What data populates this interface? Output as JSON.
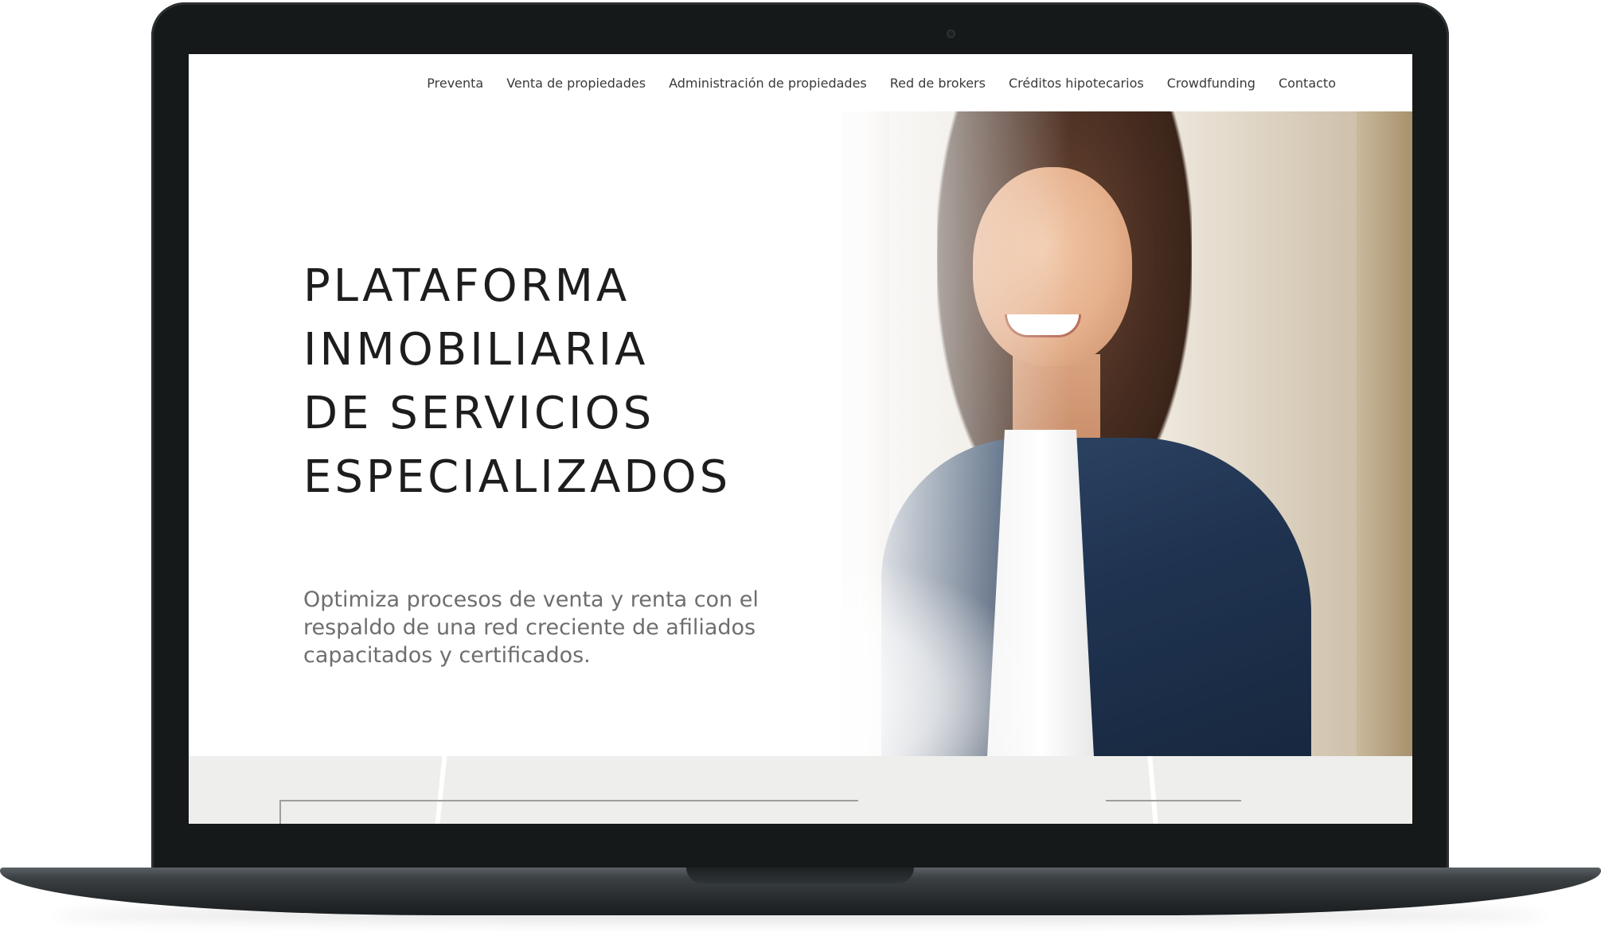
{
  "nav": {
    "items": [
      "Preventa",
      "Venta de propiedades",
      "Administración de propiedades",
      "Red de brokers",
      "Créditos hipotecarios",
      "Crowdfunding",
      "Contacto"
    ]
  },
  "hero": {
    "headline_lines": [
      "PLATAFORMA",
      "INMOBILIARIA",
      "DE SERVICIOS",
      "ESPECIALIZADOS"
    ],
    "subtitle": "Optimiza procesos de venta y renta con el respaldo de una red creciente de afiliados capacitados y certificados.",
    "image_icon": "businesswoman-photo"
  },
  "colors": {
    "laptop_frame": "#15191a",
    "text_dark": "#1d1d1d",
    "text_muted": "#6e6e6e",
    "lower_section": "#eeeeec"
  }
}
